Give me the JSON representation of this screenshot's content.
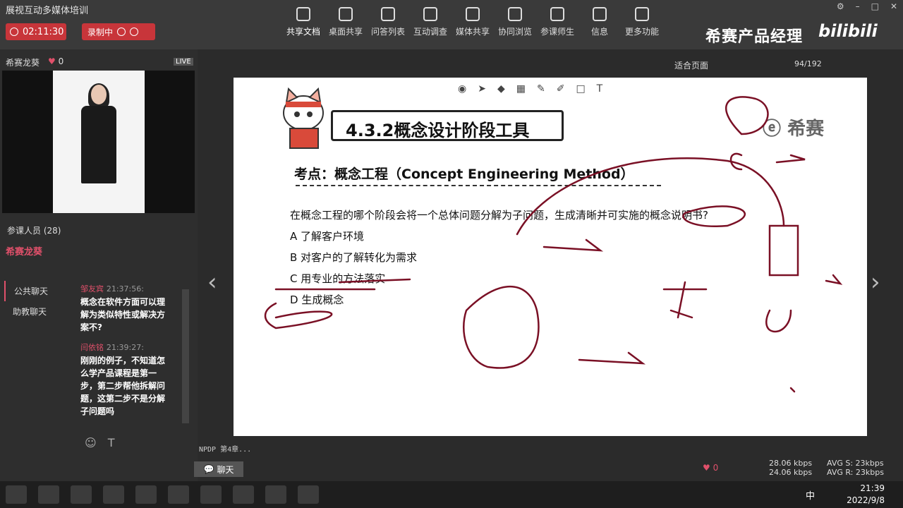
{
  "app": {
    "title": "展视互动多媒体培训",
    "timer": "02:11:30",
    "recording_label": "录制中"
  },
  "toolbar": {
    "items": [
      {
        "label": "共享文档"
      },
      {
        "label": "桌面共享"
      },
      {
        "label": "问答列表"
      },
      {
        "label": "互动调查"
      },
      {
        "label": "媒体共享"
      },
      {
        "label": "协同浏览"
      },
      {
        "label": "参课师生"
      },
      {
        "label": "信息"
      },
      {
        "label": "更多功能"
      }
    ]
  },
  "brand": {
    "name": "希赛产品经理",
    "site": "bilibili"
  },
  "presenter": {
    "name": "希赛龙葵",
    "likes": "0",
    "live": "LIVE"
  },
  "participants": {
    "label": "参课人员 (28)",
    "me": "希赛龙葵"
  },
  "chat": {
    "tabs": [
      "公共聊天",
      "助教聊天"
    ],
    "messages": [
      {
        "who": "邹友宾",
        "time": "21:37:56:",
        "text": "概念在软件方面可以理解为类似特性或解决方案不?"
      },
      {
        "who": "闫依铭",
        "time": "21:39:27:",
        "text": "刚刚的例子，不知道怎么学产品课程是第一步，第二步帮他拆解问题，这第二步不是分解子问题吗"
      }
    ],
    "button": "聊天"
  },
  "doc": {
    "zoom": "适合页面",
    "page": "94/192"
  },
  "slide": {
    "title": "4.3.2概念设计阶段工具",
    "logo": "希赛",
    "point": "考点：概念工程（Concept Engineering Method）",
    "question": "在概念工程的哪个阶段会将一个总体问题分解为子问题，生成清晰并可实施的概念说明书?",
    "options": [
      "A 了解客户环境",
      "B 对客户的了解转化为需求",
      "C 用专业的方法落实",
      "D 生成概念"
    ]
  },
  "footer": {
    "status": "NPDP 第4章...",
    "likes": "0",
    "rate_up": "28.06 kbps",
    "rate_down": "24.06 kbps",
    "avg_s": "AVG S: 23kbps",
    "avg_r": "AVG R: 23kbps"
  },
  "taskbar": {
    "ime": "中",
    "time": "21:39",
    "date": "2022/9/8"
  }
}
